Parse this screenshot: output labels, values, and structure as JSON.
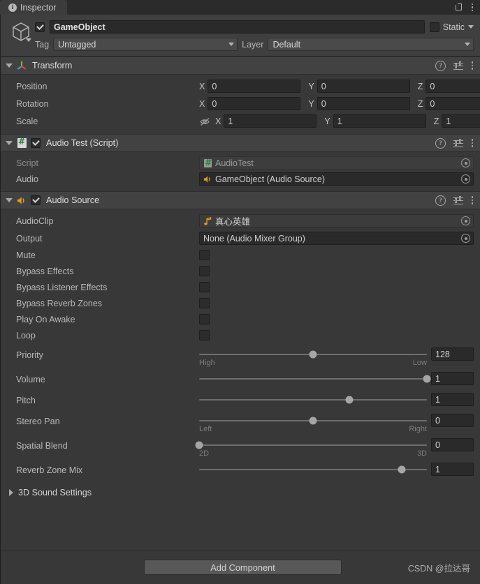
{
  "window": {
    "tab_label": "Inspector",
    "tab_icon": "info-icon",
    "lock_icon": "lock-icon",
    "menu_icon": "kebab-menu-icon"
  },
  "object_header": {
    "icon": "cube-icon",
    "enabled": true,
    "name": "GameObject",
    "static_label": "Static",
    "static_checked": false,
    "tag_label": "Tag",
    "tag_value": "Untagged",
    "layer_label": "Layer",
    "layer_value": "Default"
  },
  "components": [
    {
      "id": "transform",
      "title": "Transform",
      "icon": "transform-gizmo-icon",
      "expanded": true,
      "has_enable_checkbox": false,
      "rows": [
        {
          "label": "Position",
          "x": "0",
          "y": "0",
          "z": "0"
        },
        {
          "label": "Rotation",
          "x": "0",
          "y": "0",
          "z": "0"
        },
        {
          "label": "Scale",
          "x": "1",
          "y": "1",
          "z": "1",
          "constrain_icon": "eye-off-icon"
        }
      ],
      "axis_labels": {
        "x": "X",
        "y": "Y",
        "z": "Z"
      }
    },
    {
      "id": "audio-test-script",
      "title": "Audio Test (Script)",
      "icon": "csharp-script-icon",
      "expanded": true,
      "enabled": true,
      "fields": [
        {
          "label": "Script",
          "value": "AudioTest",
          "icon": "csharp-script-icon",
          "disabled": true
        },
        {
          "label": "Audio",
          "value": "GameObject (Audio Source)",
          "icon": "audio-source-icon",
          "disabled": false
        }
      ]
    },
    {
      "id": "audio-source",
      "title": "Audio Source",
      "icon": "audio-source-icon",
      "expanded": true,
      "enabled": true
    }
  ],
  "audio_source": {
    "clip": {
      "label": "AudioClip",
      "value": "真心英雄",
      "icon": "music-note-icon"
    },
    "output": {
      "label": "Output",
      "value": "None (Audio Mixer Group)"
    },
    "toggles": [
      {
        "label": "Mute",
        "checked": false
      },
      {
        "label": "Bypass Effects",
        "checked": false
      },
      {
        "label": "Bypass Listener Effects",
        "checked": false
      },
      {
        "label": "Bypass Reverb Zones",
        "checked": false
      },
      {
        "label": "Play On Awake",
        "checked": false
      },
      {
        "label": "Loop",
        "checked": false
      }
    ],
    "sliders": [
      {
        "label": "Priority",
        "value": "128",
        "percent": 50,
        "left_sub": "High",
        "right_sub": "Low"
      },
      {
        "label": "Volume",
        "value": "1",
        "percent": 100,
        "left_sub": "",
        "right_sub": ""
      },
      {
        "label": "Pitch",
        "value": "1",
        "percent": 66,
        "left_sub": "",
        "right_sub": ""
      },
      {
        "label": "Stereo Pan",
        "value": "0",
        "percent": 50,
        "left_sub": "Left",
        "right_sub": "Right"
      },
      {
        "label": "Spatial Blend",
        "value": "0",
        "percent": 0,
        "left_sub": "2D",
        "right_sub": "3D"
      },
      {
        "label": "Reverb Zone Mix",
        "value": "1",
        "percent": 88,
        "left_sub": "",
        "right_sub": ""
      }
    ],
    "sound_settings_3d": {
      "label": "3D Sound Settings",
      "expanded": false
    }
  },
  "footer": {
    "add_component_label": "Add Component",
    "watermark": "CSDN @拉达哥"
  },
  "colors": {
    "panel_bg": "#383838",
    "header_bg": "#424242",
    "field_bg": "#2a2a2a",
    "accent_audio": "#e0a020",
    "accent_script": "#2f7d3f"
  }
}
